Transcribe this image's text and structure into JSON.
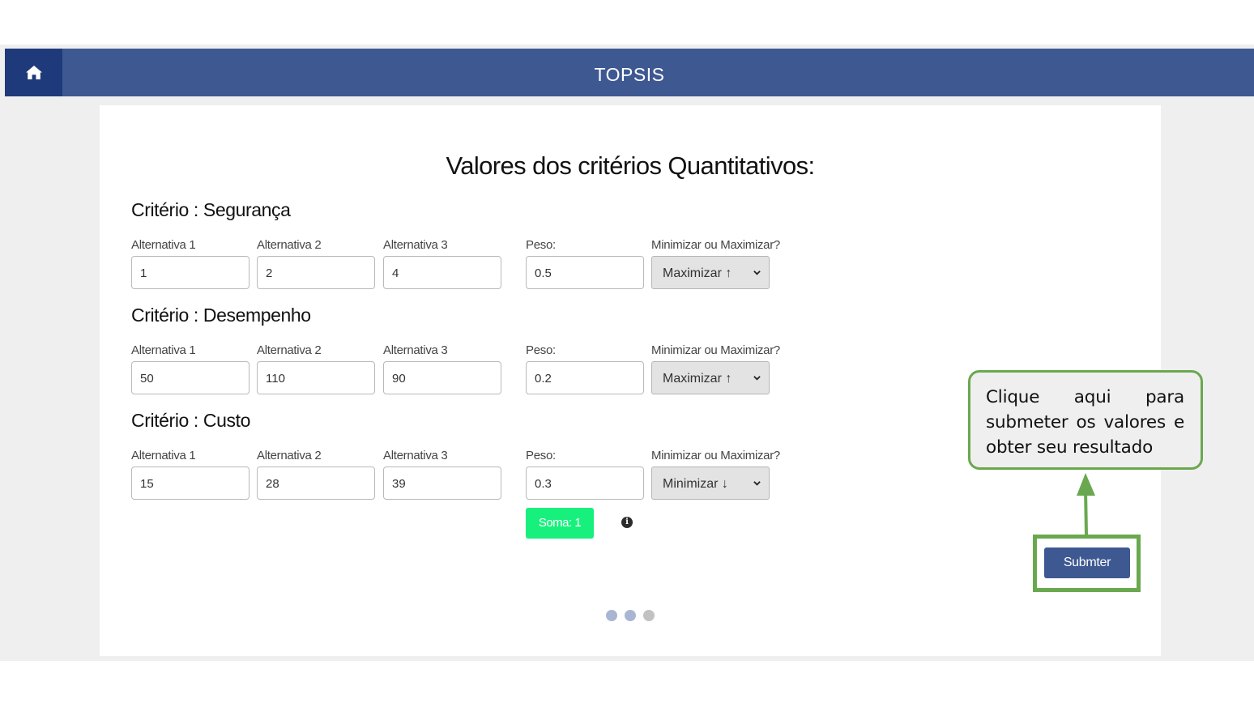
{
  "nav": {
    "title": "TOPSIS",
    "home_icon": "home-icon"
  },
  "main": {
    "heading": "Valores dos critérios Quantitativos:",
    "criteria": [
      {
        "title": "Critério : Segurança",
        "labels": [
          "Alternativa 1",
          "Alternativa 2",
          "Alternativa 3",
          "Peso:",
          "Minimizar ou Maximizar?"
        ],
        "values": [
          "1",
          "2",
          "4"
        ],
        "peso": "0.5",
        "direction": "Maximizar ↑"
      },
      {
        "title": "Critério : Desempenho",
        "labels": [
          "Alternativa 1",
          "Alternativa 2",
          "Alternativa 3",
          "Peso:",
          "Minimizar ou Maximizar?"
        ],
        "values": [
          "50",
          "110",
          "90"
        ],
        "peso": "0.2",
        "direction": "Maximizar ↑"
      },
      {
        "title": "Critério : Custo",
        "labels": [
          "Alternativa 1",
          "Alternativa 2",
          "Alternativa 3",
          "Peso:",
          "Minimizar ou Maximizar?"
        ],
        "values": [
          "15",
          "28",
          "39"
        ],
        "peso": "0.3",
        "direction": "Minimizar ↓"
      }
    ],
    "soma_label": "Soma: 1",
    "info_icon": "info-icon",
    "submit_label": "Submter",
    "pagination": {
      "pages": 3,
      "active": 2
    }
  },
  "annotation": {
    "callout_text": "Clique aqui para submeter os valores e obter seu resultado",
    "color": "#6aa84f"
  },
  "colors": {
    "navbar": "#3e5891",
    "home": "#1f3a7a",
    "soma": "#18f07e",
    "submit": "#3e5891"
  }
}
